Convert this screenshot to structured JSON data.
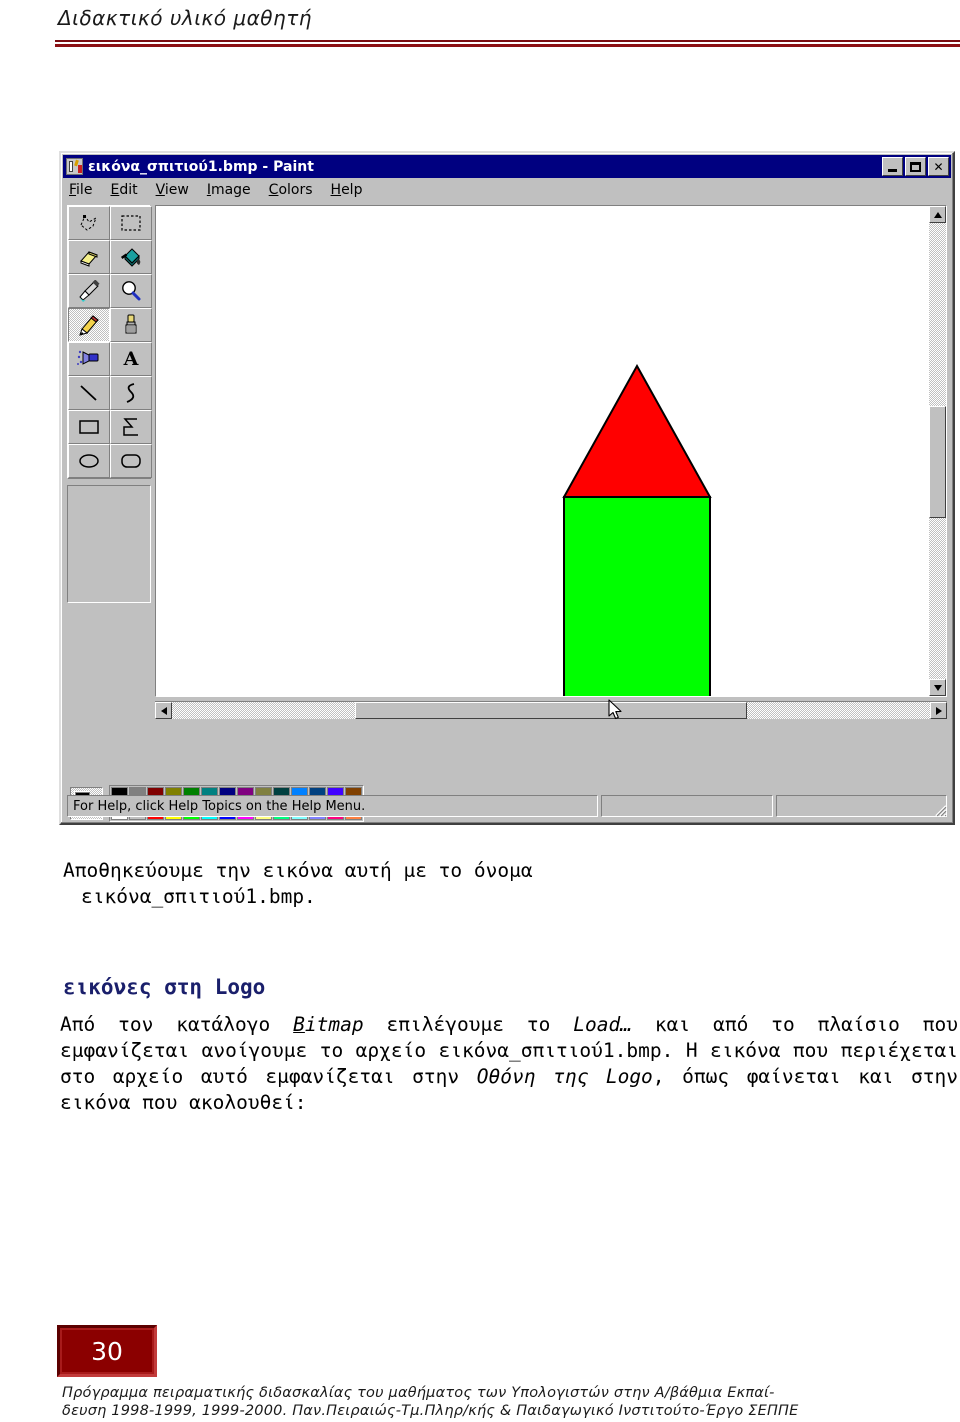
{
  "page": {
    "header_title": "Διδακτικό υλικό μαθητή",
    "page_number": "30",
    "footer_line1": "Πρόγραμμα πειραματικής διδασκαλίας του μαθήματος των Υπολογιστών στην  Α/βάθμια Εκπαί-",
    "footer_line2": "δευση 1998-1999, 1999-2000. Παν.Πειραιώς-Τμ.Πληρ/κής & Παιδαγωγικό Ινστιτούτο-Έργο ΣΕΠΠΕ",
    "accent_color": "#8b0000",
    "heading_color": "#1a1f6b"
  },
  "paint_window": {
    "title": "εικόνα_σπιτιού1.bmp - Paint",
    "icon_name": "paint-app-icon",
    "window_buttons": [
      {
        "name": "minimize-button",
        "label": "_"
      },
      {
        "name": "maximize-button",
        "label": "□"
      },
      {
        "name": "close-button",
        "label": "✕"
      }
    ],
    "menus": [
      {
        "label": "File",
        "accel": "F"
      },
      {
        "label": "Edit",
        "accel": "E"
      },
      {
        "label": "View",
        "accel": "V"
      },
      {
        "label": "Image",
        "accel": "I"
      },
      {
        "label": "Colors",
        "accel": "C"
      },
      {
        "label": "Help",
        "accel": "H"
      }
    ],
    "tools": [
      {
        "name": "free-form-select-tool-icon",
        "selected": false
      },
      {
        "name": "rectangle-select-tool-icon",
        "selected": false
      },
      {
        "name": "eraser-tool-icon",
        "selected": false
      },
      {
        "name": "fill-with-color-tool-icon",
        "selected": false
      },
      {
        "name": "pick-color-tool-icon",
        "selected": false
      },
      {
        "name": "magnifier-tool-icon",
        "selected": false
      },
      {
        "name": "pencil-tool-icon",
        "selected": true
      },
      {
        "name": "brush-tool-icon",
        "selected": false
      },
      {
        "name": "airbrush-tool-icon",
        "selected": false
      },
      {
        "name": "text-tool-icon",
        "selected": false
      },
      {
        "name": "line-tool-icon",
        "selected": false
      },
      {
        "name": "curve-tool-icon",
        "selected": false
      },
      {
        "name": "rectangle-tool-icon",
        "selected": false
      },
      {
        "name": "polygon-tool-icon",
        "selected": false
      },
      {
        "name": "ellipse-tool-icon",
        "selected": false
      },
      {
        "name": "rounded-rectangle-tool-icon",
        "selected": false
      }
    ],
    "drawing": {
      "description": "house: red triangle roof over green square body",
      "roof_color": "#ff0000",
      "body_color": "#00ff00",
      "outline_color": "#000000"
    },
    "palette": {
      "foreground_color": "#000000",
      "background_color": "#ffffff",
      "row1": [
        "#000000",
        "#808080",
        "#800000",
        "#808000",
        "#008000",
        "#008080",
        "#000080",
        "#800080",
        "#808040",
        "#004040",
        "#0080ff",
        "#004080",
        "#4000ff",
        "#804000"
      ],
      "row2": [
        "#ffffff",
        "#c0c0c0",
        "#ff0000",
        "#ffff00",
        "#00ff00",
        "#00ffff",
        "#0000ff",
        "#ff00ff",
        "#ffff80",
        "#00ff80",
        "#80ffff",
        "#8080ff",
        "#ff0080",
        "#ff8040"
      ]
    },
    "statusbar": {
      "message": "For Help, click Help Topics on the Help Menu.",
      "panel_2": "",
      "panel_3": ""
    },
    "scrollbars": {
      "vertical_name": "canvas-vertical-scrollbar",
      "horizontal_name": "canvas-horizontal-scrollbar"
    }
  },
  "content": {
    "para1_line1": "Αποθηκεύουμε την εικόνα αυτή με το όνομα",
    "para1_line2": "εικόνα_σπιτιού1.bmp.",
    "heading": "εικόνες στη Logo",
    "para2_a": "Από τον κατάλογο ",
    "para2_bitmap_b": "B",
    "para2_bitmap_rest": "itmap",
    "para2_b": " επιλέγουμε το ",
    "para2_load": "Load…",
    "para2_c": " και από το πλαίσιο που εμφανίζεται ανοίγουμε το αρχείο εικόνα_σπιτιού1.bmp. Η εικόνα που περιέχεται στο αρχείο αυτό εμφανίζεται στην ",
    "para2_othoni": "Οθόνη της Logo",
    "para2_d": ", όπως φαίνεται και στην εικόνα που ακολουθεί:"
  }
}
